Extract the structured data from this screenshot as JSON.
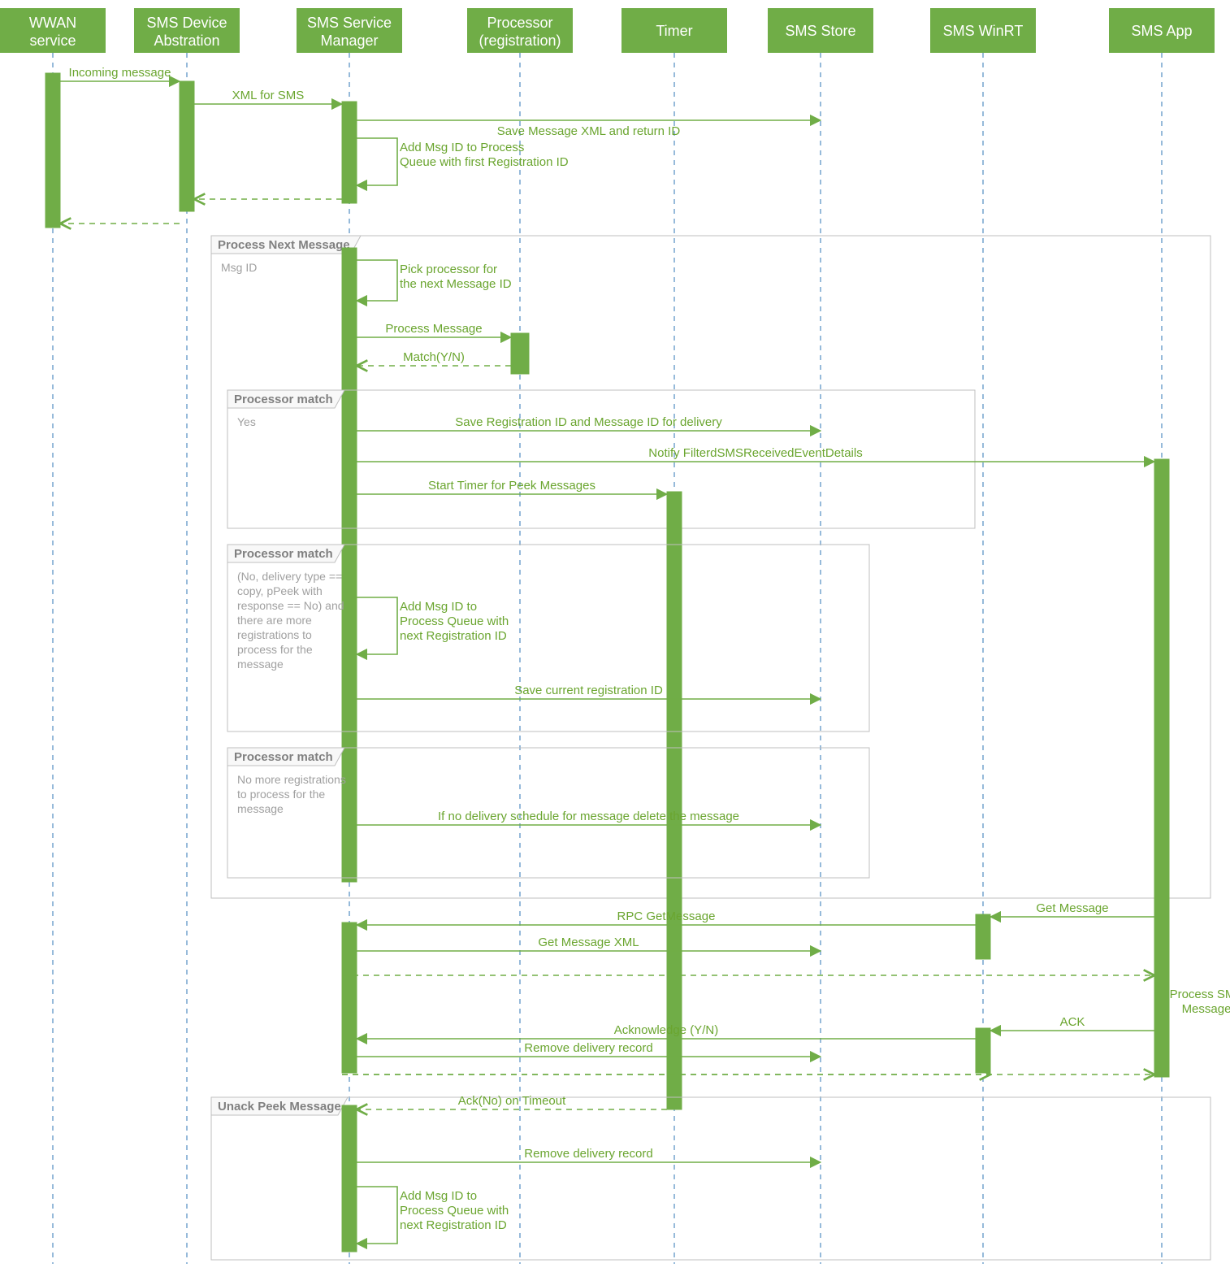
{
  "lanes": {
    "wwan": {
      "label1": "WWAN",
      "label2": "service"
    },
    "dev": {
      "label1": "SMS Device",
      "label2": "Abstration"
    },
    "mgr": {
      "label1": "SMS Service",
      "label2": "Manager"
    },
    "proc": {
      "label1": "Processor",
      "label2": "(registration)"
    },
    "timer": {
      "label1": "Timer",
      "label2": ""
    },
    "store": {
      "label1": "SMS Store",
      "label2": ""
    },
    "winrt": {
      "label1": "SMS WinRT",
      "label2": ""
    },
    "app": {
      "label1": "SMS App",
      "label2": ""
    }
  },
  "messages": {
    "incoming": "Incoming message",
    "xml_for_sms": "XML for SMS",
    "save_xml": "Save Message XML and return ID",
    "add_msg_first": "Add Msg ID to Process\nQueue with first Registration ID",
    "pick_proc": "Pick processor for\nthe next Message ID",
    "process_msg": "Process Message",
    "match": "Match(Y/N)",
    "save_regid": "Save Registration ID and Message ID for delivery",
    "notify": "Notify FilterdSMSReceivedEventDetails",
    "start_timer": "Start Timer for Peek Messages",
    "add_msg_next": "Add Msg ID to\nProcess Queue with\nnext Registration ID",
    "save_current": "Save current registration ID",
    "no_delivery": "If no delivery schedule for message delete the message",
    "get_msg": "Get Message",
    "rpc_get": "RPC GetMessage",
    "get_msg_xml": "Get Message XML",
    "process_sms": "Process SMS\nMessage",
    "ack_app": "ACK",
    "ack_yn": "Acknowledge (Y/N)",
    "remove_delivery": "Remove delivery record",
    "ack_timeout": "Ack(No) on Timeout",
    "remove_delivery2": "Remove delivery record",
    "add_msg_next2": "Add Msg ID to\nProcess Queue with\nnext Registration ID"
  },
  "frames": {
    "process_next": {
      "title": "Process Next Message",
      "guard": "Msg ID"
    },
    "pm1": {
      "title": "Processor match",
      "guard": "Yes"
    },
    "pm2": {
      "title": "Processor match",
      "guard": "(No, delivery type ==\ncopy, pPeek with\nresponse == No) and\nthere are more\nregistrations to\nprocess for the\nmessage"
    },
    "pm3": {
      "title": "Processor match",
      "guard": "No more registrations\nto process for the\nmessage"
    },
    "unack": {
      "title": "Unack Peek Message",
      "guard": ""
    }
  },
  "colors": {
    "green": "#70AD47",
    "green_fill": "#70AD47",
    "light_green": "#8bc34a",
    "gray_border": "#bfbfbf",
    "gray_text": "#808080",
    "lifeline": "#2e74b5"
  }
}
